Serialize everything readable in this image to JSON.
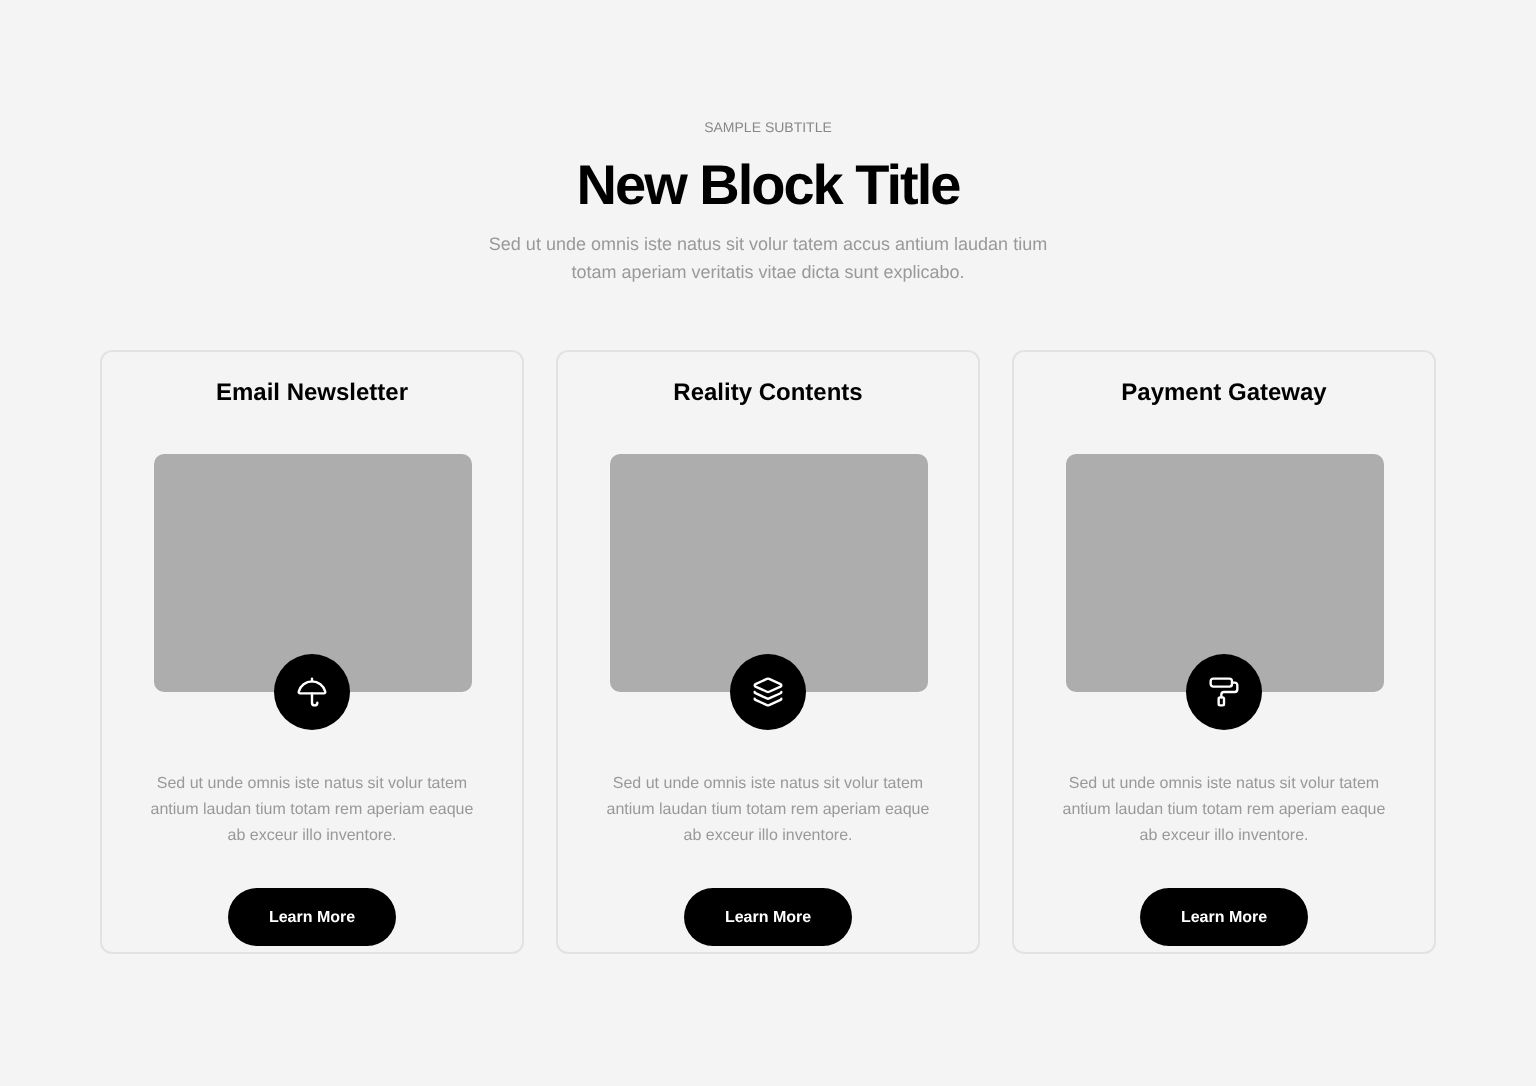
{
  "header": {
    "subtitle": "SAMPLE SUBTITLE",
    "title": "New Block Title",
    "description": "Sed ut unde omnis iste natus sit volur tatem accus antium laudan tium totam aperiam veritatis vitae dicta sunt explicabo."
  },
  "cards": [
    {
      "title": "Email Newsletter",
      "kind": "umbrella",
      "text": "Sed ut unde omnis iste natus sit volur tatem antium laudan tium totam rem aperiam eaque ab exceur illo inventore.",
      "button": "Learn More"
    },
    {
      "title": "Reality Contents",
      "kind": "layers",
      "text": "Sed ut unde omnis iste natus sit volur tatem antium laudan tium totam rem aperiam eaque ab exceur illo inventore.",
      "button": "Learn More"
    },
    {
      "title": "Payment Gateway",
      "kind": "roller",
      "text": "Sed ut unde omnis iste natus sit volur tatem antium laudan tium totam rem aperiam eaque ab exceur illo inventore.",
      "button": "Learn More"
    }
  ]
}
